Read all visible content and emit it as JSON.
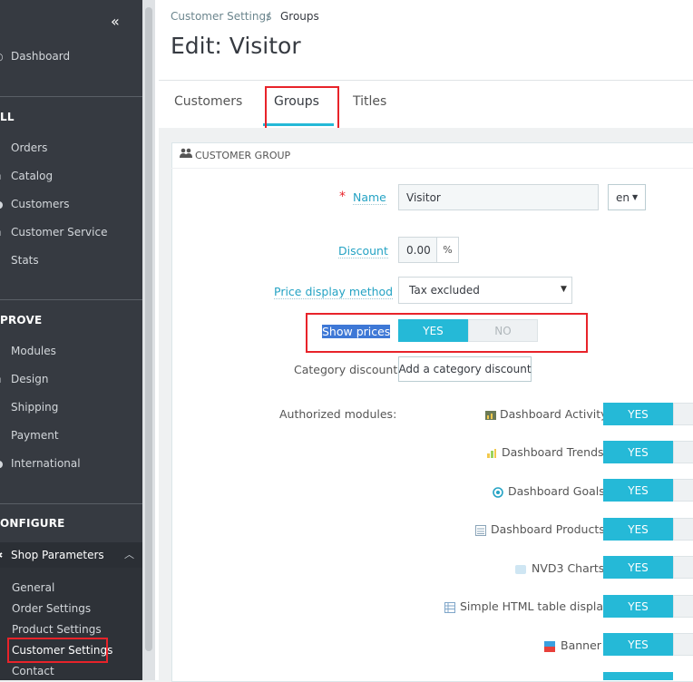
{
  "sidebar": {
    "collapse": "«",
    "dashboard": "Dashboard",
    "sell_title": "LL",
    "sell_items": [
      "Orders",
      "Catalog",
      "Customers",
      "Customer Service",
      "Stats"
    ],
    "improve_title": "PROVE",
    "improve_items": [
      "Modules",
      "Design",
      "Shipping",
      "Payment",
      "International"
    ],
    "configure_title": "ONFIGURE",
    "shop_parameters": "Shop Parameters",
    "shop_sub": [
      "General",
      "Order Settings",
      "Product Settings",
      "Customer Settings",
      "Contact"
    ]
  },
  "breadcrumb": {
    "parent": "Customer Settings",
    "separator": "/",
    "current": "Groups"
  },
  "page_title": "Edit: Visitor",
  "tabs": [
    "Customers",
    "Groups",
    "Titles"
  ],
  "panel": {
    "title": "CUSTOMER GROUP",
    "name_label": "Name",
    "name_required": "*",
    "name_value": "Visitor",
    "lang": "en",
    "discount_label": "Discount",
    "discount_value": "0.00",
    "discount_unit": "%",
    "price_display_label": "Price display method",
    "price_display_value": "Tax excluded",
    "show_prices_label": "Show prices",
    "show_prices_yes": "YES",
    "show_prices_no": "NO",
    "category_discount_label": "Category discount",
    "category_discount_button": "Add a category discount",
    "authorized_modules_label": "Authorized modules:"
  },
  "modules": [
    {
      "name": "Dashboard Activity",
      "icon": "dashboard-activity-icon",
      "state": "YES"
    },
    {
      "name": "Dashboard Trends",
      "icon": "dashboard-trends-icon",
      "state": "YES"
    },
    {
      "name": "Dashboard Goals",
      "icon": "dashboard-goals-icon",
      "state": "YES"
    },
    {
      "name": "Dashboard Products",
      "icon": "dashboard-products-icon",
      "state": "YES"
    },
    {
      "name": "NVD3 Charts",
      "icon": "nvd3-charts-icon",
      "state": "YES"
    },
    {
      "name": "Simple HTML table display",
      "icon": "html-table-icon",
      "state": "YES"
    },
    {
      "name": "Banner",
      "icon": "banner-icon",
      "state": "YES"
    }
  ],
  "colors": {
    "accent": "#25b9d7",
    "sidebar": "#363a41",
    "annotation": "#e8232a"
  }
}
